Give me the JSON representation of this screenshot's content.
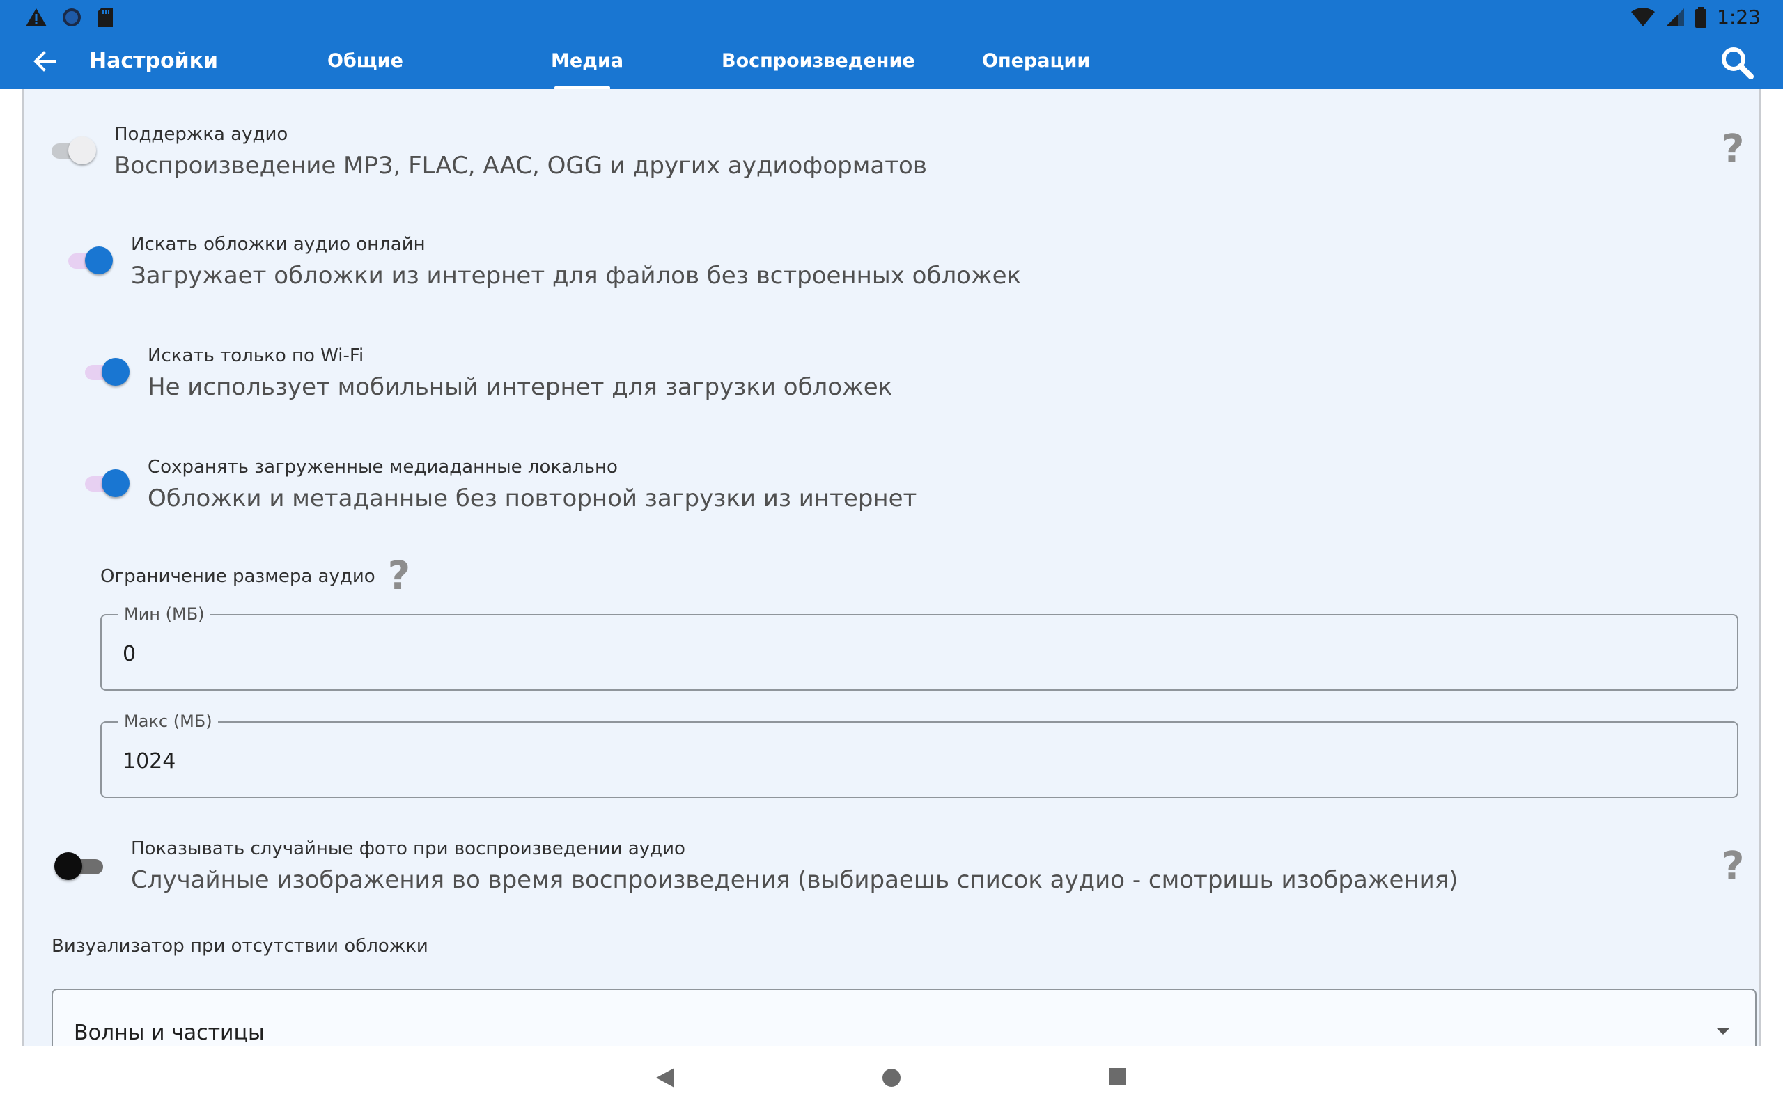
{
  "status_bar": {
    "time": "1:23",
    "icons": [
      "warning-icon",
      "circle-icon",
      "sd-card-icon",
      "wifi-icon",
      "signal-icon",
      "battery-icon"
    ]
  },
  "app_bar": {
    "title": "Настройки",
    "tabs": [
      {
        "label": "Общие",
        "active": false
      },
      {
        "label": "Медиа",
        "active": true
      },
      {
        "label": "Воспроизведение",
        "active": false
      },
      {
        "label": "Операции",
        "active": false
      }
    ]
  },
  "settings": {
    "audio_support": {
      "title": "Поддержка аудио",
      "subtitle": "Воспроизведение MP3, FLAC, AAC, OGG и других аудиоформатов",
      "enabled": false
    },
    "online_covers": {
      "title": "Искать обложки аудио онлайн",
      "subtitle": "Загружает обложки из интернет для файлов без встроенных обложек",
      "enabled": true
    },
    "wifi_only": {
      "title": "Искать только по Wi-Fi",
      "subtitle": "Не использует мобильный интернет для загрузки обложек",
      "enabled": true
    },
    "save_local": {
      "title": "Сохранять загруженные медиаданные локально",
      "subtitle": "Обложки и метаданные без повторной загрузки из интернет",
      "enabled": true
    },
    "size_limit": {
      "title": "Ограничение размера аудио",
      "min_label": "Мин (МБ)",
      "min_value": "0",
      "max_label": "Макс (МБ)",
      "max_value": "1024"
    },
    "random_photos": {
      "title": "Показывать случайные фото при воспроизведении аудио",
      "subtitle": "Случайные изображения во время воспроизведения (выбираешь список аудио - смотришь изображения)",
      "enabled": false
    },
    "visualizer": {
      "title": "Визуализатор при отсутствии обложки",
      "selected": "Волны и частицы"
    }
  },
  "help_glyph": "?",
  "colors": {
    "primary": "#1976d2",
    "switch_on_thumb": "#1976d2",
    "switch_on_track": "#e7d0f2",
    "content_bg": "#eef4fc"
  }
}
